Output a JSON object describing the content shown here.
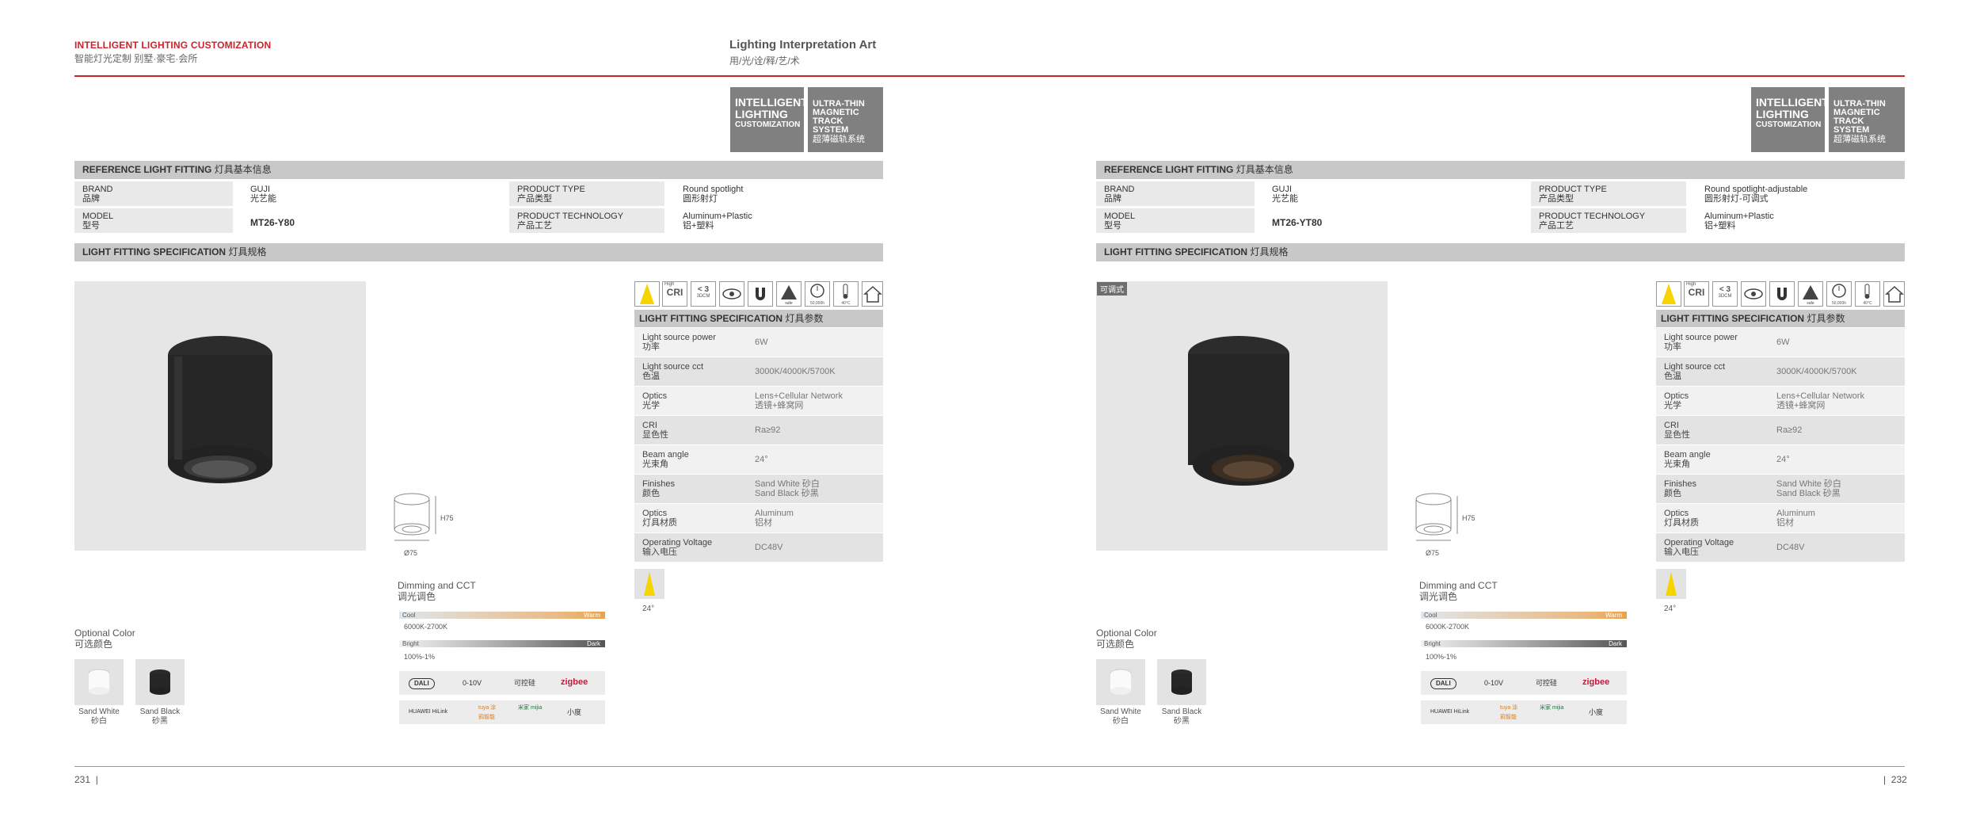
{
  "header": {
    "left_title": "INTELLIGENT LIGHTING CUSTOMIZATION",
    "left_subtitle": "智能灯光定制 别墅·豪宅·会所",
    "center_title": "Lighting Interpretation Art",
    "center_subtitle": "用/光/诠/释/艺/术"
  },
  "badge": {
    "line1": "INTELLIGENT",
    "line2": "LIGHTING",
    "line3": "CUSTOMIZATION",
    "right1": "ULTRA-THIN",
    "right2": "MAGNETIC",
    "right3": "TRACK SYSTEM",
    "right_cn": "超薄磁轨系统"
  },
  "section_reference": {
    "en": "REFERENCE LIGHT FITTING",
    "cn": "灯具基本信息"
  },
  "section_spec": {
    "en": "LIGHT FITTING SPECIFICATION",
    "cn": "灯具规格"
  },
  "info_labels": {
    "brand_en": "BRAND",
    "brand_cn": "品牌",
    "model_en": "MODEL",
    "model_cn": "型号",
    "ptype_en": "PRODUCT TYPE",
    "ptype_cn": "产品类型",
    "ptech_en": "PRODUCT TECHNOLOGY",
    "ptech_cn": "产品工艺"
  },
  "left_page": {
    "brand_en": "GUJI",
    "brand_cn": "光艺能",
    "model": "MT26-Y80",
    "ptype_en": "Round spotlight",
    "ptype_cn": "圆形射灯",
    "ptech_en": "Aluminum+Plastic",
    "ptech_cn": "铝+塑料",
    "page_number": "231"
  },
  "right_page": {
    "tag": "可调式",
    "brand_en": "GUJI",
    "brand_cn": "光艺能",
    "model": "MT26-YT80",
    "ptype_en": "Round spotlight-adjustable",
    "ptype_cn": "圆形射灯-可调式",
    "ptech_en": "Aluminum+Plastic",
    "ptech_cn": "铝+塑料",
    "page_number": "232"
  },
  "icons": {
    "cri_high": "High",
    "cri": "CRI",
    "ugr": "< 3",
    "ugr_sub": "3DCM",
    "eye": "eye-icon",
    "magnet": "magnet-icon",
    "safe": "safe-icon",
    "lifetime": "50,000h",
    "temp": "40°C",
    "indoor": "house-icon"
  },
  "spec_table": {
    "title_en": "LIGHT FITTING SPECIFICATION",
    "title_cn": "灯具参数",
    "rows": [
      {
        "en": "Light source power",
        "cn": "功率",
        "val1": "6W",
        "val2": ""
      },
      {
        "en": "Light source cct",
        "cn": "色温",
        "val1": "3000K/4000K/5700K",
        "val2": ""
      },
      {
        "en": "Optics",
        "cn": "光学",
        "val1": "Lens+Cellular Network",
        "val2": "透镜+蜂窝网"
      },
      {
        "en": "CRI",
        "cn": "显色性",
        "val1": "Ra≥92",
        "val2": ""
      },
      {
        "en": "Beam angle",
        "cn": "光束角",
        "val1": "24°",
        "val2": ""
      },
      {
        "en": "Finishes",
        "cn": "颜色",
        "val1": "Sand White 砂白",
        "val2": "Sand Black 砂黑"
      },
      {
        "en": "Optics",
        "cn": "灯具材质",
        "val1": "Aluminum",
        "val2": "铝材"
      },
      {
        "en": "Operating Voltage",
        "cn": "输入电压",
        "val1": "DC48V",
        "val2": ""
      }
    ]
  },
  "beam": {
    "angle": "24°"
  },
  "dimensions": {
    "height": "H75",
    "diameter": "Ø75"
  },
  "dimming": {
    "title_en": "Dimming and CCT",
    "title_cn": "调光调色",
    "cool": "Cool",
    "warm": "Warm",
    "cct_range": "6000K-2700K",
    "bright": "Bright",
    "dark": "Dark",
    "dim_range": "100%-1%",
    "protocols": [
      "DALI",
      "0-10V",
      "可控硅",
      "zigbee"
    ],
    "platforms": [
      "HUAWEI HiLink",
      "tuya 涂鸦智能",
      "米家 mijia",
      "小度"
    ]
  },
  "optional_color": {
    "title_en": "Optional Color",
    "title_cn": "可选颜色",
    "white_en": "Sand White",
    "white_cn": "砂白",
    "black_en": "Sand Black",
    "black_cn": "砂黑"
  },
  "colors": {
    "accent": "#cc2229",
    "badge": "#808080",
    "section": "#c8c8c8"
  }
}
